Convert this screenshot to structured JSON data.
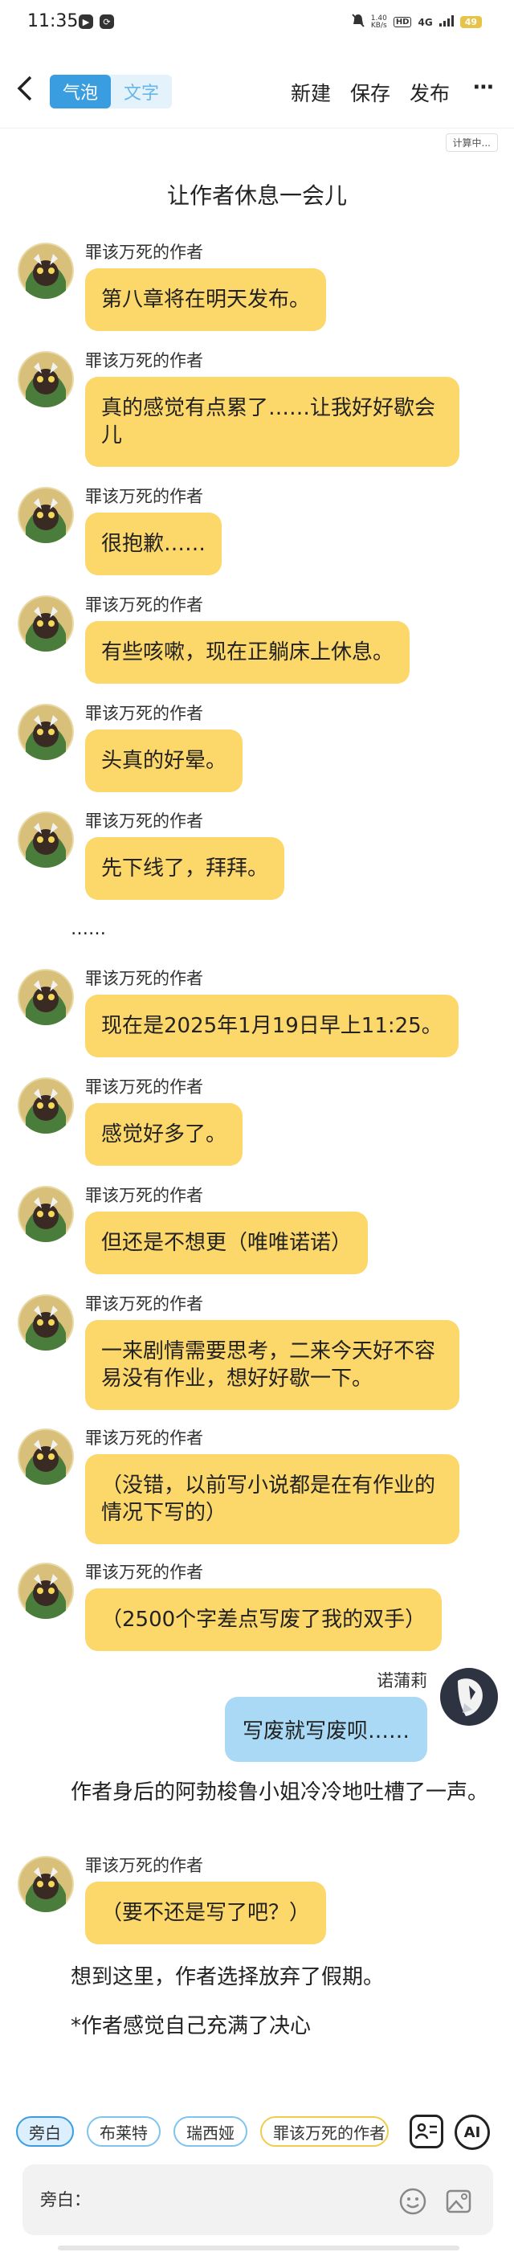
{
  "status_bar": {
    "time": "11:35",
    "speed": "1.40\nKB/s",
    "hd": "HD",
    "network": "4G",
    "battery": "49"
  },
  "topbar": {
    "tabs": [
      {
        "label": "气泡",
        "active": true
      },
      {
        "label": "文字",
        "active": false
      }
    ],
    "new_label": "新建",
    "save_label": "保存",
    "publish_label": "发布",
    "more_label": "⋯"
  },
  "calc_badge": "计算中...",
  "title": "让作者休息一会儿",
  "messages": [
    {
      "author": "罪该万死的作者",
      "text": "第八章将在明天发布。"
    },
    {
      "author": "罪该万死的作者",
      "text": "真的感觉有点累了……让我好好歇会儿"
    },
    {
      "author": "罪该万死的作者",
      "text": "很抱歉……"
    },
    {
      "author": "罪该万死的作者",
      "text": "有些咳嗽，现在正躺床上休息。"
    },
    {
      "author": "罪该万死的作者",
      "text": "头真的好晕。"
    },
    {
      "author": "罪该万死的作者",
      "text": "先下线了，拜拜。"
    },
    {
      "author": "罪该万死的作者",
      "text": "现在是2025年1月19日早上11:25。"
    },
    {
      "author": "罪该万死的作者",
      "text": "感觉好多了。"
    },
    {
      "author": "罪该万死的作者",
      "text": "但还是不想更（唯唯诺诺）"
    },
    {
      "author": "罪该万死的作者",
      "text": "一来剧情需要思考，二来今天好不容易没有作业，想好好歇一下。"
    },
    {
      "author": "罪该万死的作者",
      "text": "（没错，以前写小说都是在有作业的情况下写的）"
    },
    {
      "author": "罪该万死的作者",
      "text": "（2500个字差点写废了我的双手）"
    },
    {
      "author": "罪该万死的作者",
      "text": "（要不还是写了吧？）"
    }
  ],
  "ellipsis": "……",
  "right_message": {
    "author": "诺蒲莉",
    "text": "写废就写废呗……"
  },
  "narrations": [
    "作者身后的阿勃梭鲁小姐冷冷地吐槽了一声。",
    "想到这里，作者选择放弃了假期。",
    "*作者感觉自己充满了决心"
  ],
  "bottom": {
    "chips": [
      "旁白",
      "布莱特",
      "瑞西娅",
      "罪该万死的作者"
    ],
    "ai_label": "AI",
    "input_label": "旁白："
  },
  "colors": {
    "accent": "#3a9de0",
    "left_bubble": "#fcd76a",
    "right_bubble": "#a9d9f5"
  }
}
